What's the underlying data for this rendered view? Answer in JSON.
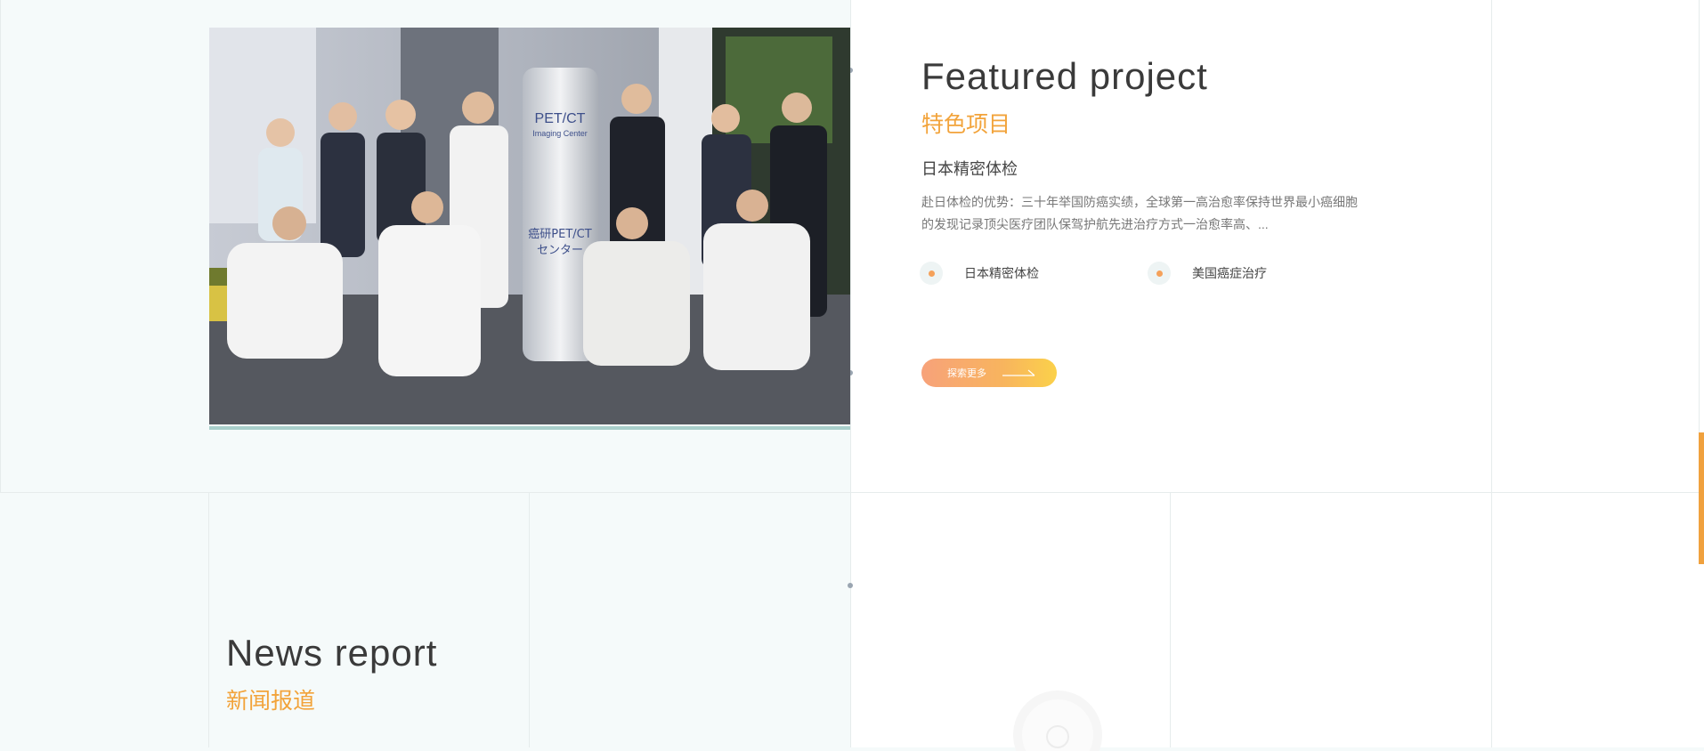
{
  "featured": {
    "title": "Featured project",
    "subtitle": "特色项目",
    "project_name": "日本精密体检",
    "description": "赴日体检的优势：三十年举国防癌实绩，全球第一高治愈率保持世界最小癌细胞的发现记录顶尖医疗团队保驾护航先进治疗方式一治愈率高、...",
    "tags": [
      "日本精密体检",
      "美国癌症治疗"
    ],
    "explore_label": "探索更多",
    "photo_sign_text": "PET/CT",
    "photo_sign_sub": "Imaging Center",
    "photo_sign_jp": "癌研PET/CT",
    "photo_sign_jp2": "センター"
  },
  "news": {
    "title": "News report",
    "subtitle": "新闻报道"
  },
  "colors": {
    "accent_orange": "#f2a33a",
    "button_gradient_start": "#f7a27a",
    "button_gradient_end": "#fbd14a",
    "tag_dot": "#f5a15a",
    "scrollbar": "#f0a13e"
  },
  "icons": {
    "explore_arrow": "long-arrow-right-icon",
    "tag_bullet": "dot-icon"
  }
}
